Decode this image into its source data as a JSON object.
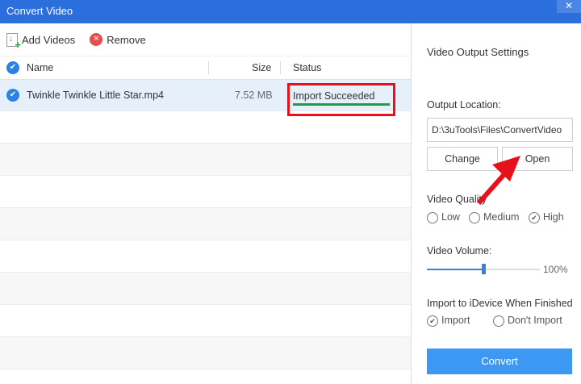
{
  "window": {
    "title": "Convert Video",
    "close": "✕"
  },
  "toolbar": {
    "add": "Add Videos",
    "remove": "Remove"
  },
  "table": {
    "headers": {
      "name": "Name",
      "size": "Size",
      "status": "Status"
    },
    "rows": [
      {
        "name": "Twinkle Twinkle Little Star.mp4",
        "size": "7.52 MB",
        "status": "Import Succeeded"
      }
    ]
  },
  "settings": {
    "title": "Video Output Settings",
    "output_label": "Output Location:",
    "output_path": "D:\\3uTools\\Files\\ConvertVideo",
    "change": "Change",
    "open": "Open",
    "quality_label": "Video Quality",
    "quality_options": [
      "Low",
      "Medium",
      "High"
    ],
    "quality_selected": "High",
    "volume_label": "Video Volume:",
    "volume_value": "100%",
    "volume_fraction": 0.5,
    "import_label": "Import to iDevice When Finished",
    "import_options": [
      "Import",
      "Don't Import"
    ],
    "import_selected": "Import",
    "convert": "Convert"
  },
  "colors": {
    "accent": "#2a6fdc",
    "button": "#3d98f4",
    "annotation": "#e8111b",
    "underline": "#1e9b4a"
  }
}
